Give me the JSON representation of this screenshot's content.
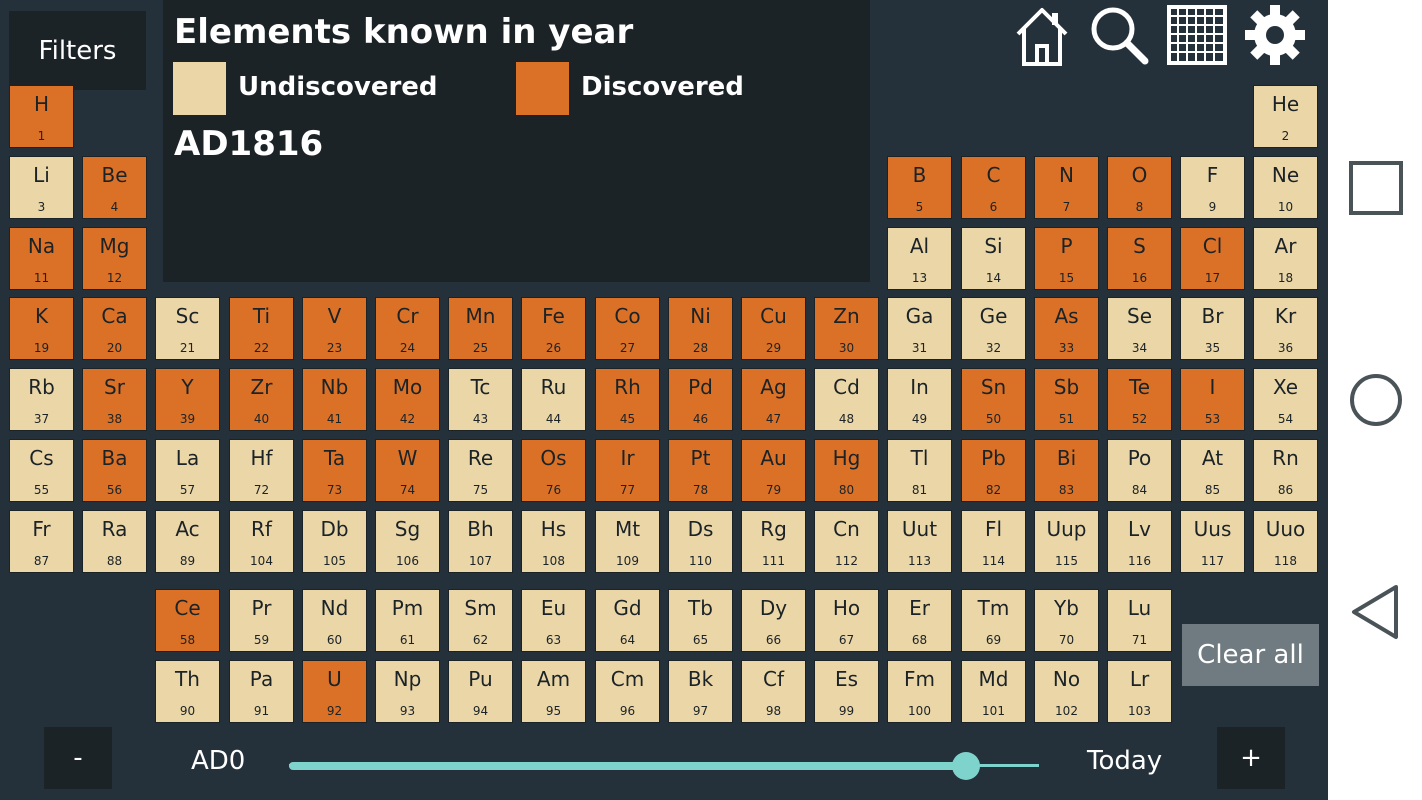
{
  "filters_label": "Filters",
  "info": {
    "title": "Elements known in year",
    "legend": {
      "undiscovered": "Undiscovered",
      "discovered": "Discovered"
    },
    "year": "AD1816"
  },
  "colors": {
    "discovered": "#db7126",
    "undiscovered": "#ebd6a7",
    "panel": "#1b2327",
    "background": "#25313a",
    "slider": "#7fd3cd"
  },
  "icons": {
    "home": "home-icon",
    "search": "search-icon",
    "grid": "grid-icon",
    "settings": "gear-icon"
  },
  "clear_all": "Clear all",
  "slider": {
    "minus": "-",
    "plus": "+",
    "start_label": "AD0",
    "end_label": "Today",
    "position_fraction": 0.902
  },
  "nav_icons": [
    "square-icon",
    "circle-icon",
    "back-triangle-icon"
  ],
  "elements": [
    {
      "sym": "H",
      "num": "1",
      "d": 1,
      "col": 1,
      "row": 1
    },
    {
      "sym": "He",
      "num": "2",
      "d": 0,
      "col": 18,
      "row": 1
    },
    {
      "sym": "Li",
      "num": "3",
      "d": 0,
      "col": 1,
      "row": 2
    },
    {
      "sym": "Be",
      "num": "4",
      "d": 1,
      "col": 2,
      "row": 2
    },
    {
      "sym": "B",
      "num": "5",
      "d": 1,
      "col": 13,
      "row": 2
    },
    {
      "sym": "C",
      "num": "6",
      "d": 1,
      "col": 14,
      "row": 2
    },
    {
      "sym": "N",
      "num": "7",
      "d": 1,
      "col": 15,
      "row": 2
    },
    {
      "sym": "O",
      "num": "8",
      "d": 1,
      "col": 16,
      "row": 2
    },
    {
      "sym": "F",
      "num": "9",
      "d": 0,
      "col": 17,
      "row": 2
    },
    {
      "sym": "Ne",
      "num": "10",
      "d": 0,
      "col": 18,
      "row": 2
    },
    {
      "sym": "Na",
      "num": "11",
      "d": 1,
      "col": 1,
      "row": 3
    },
    {
      "sym": "Mg",
      "num": "12",
      "d": 1,
      "col": 2,
      "row": 3
    },
    {
      "sym": "Al",
      "num": "13",
      "d": 0,
      "col": 13,
      "row": 3
    },
    {
      "sym": "Si",
      "num": "14",
      "d": 0,
      "col": 14,
      "row": 3
    },
    {
      "sym": "P",
      "num": "15",
      "d": 1,
      "col": 15,
      "row": 3
    },
    {
      "sym": "S",
      "num": "16",
      "d": 1,
      "col": 16,
      "row": 3
    },
    {
      "sym": "Cl",
      "num": "17",
      "d": 1,
      "col": 17,
      "row": 3
    },
    {
      "sym": "Ar",
      "num": "18",
      "d": 0,
      "col": 18,
      "row": 3
    },
    {
      "sym": "K",
      "num": "19",
      "d": 1,
      "col": 1,
      "row": 4
    },
    {
      "sym": "Ca",
      "num": "20",
      "d": 1,
      "col": 2,
      "row": 4
    },
    {
      "sym": "Sc",
      "num": "21",
      "d": 0,
      "col": 3,
      "row": 4
    },
    {
      "sym": "Ti",
      "num": "22",
      "d": 1,
      "col": 4,
      "row": 4
    },
    {
      "sym": "V",
      "num": "23",
      "d": 1,
      "col": 5,
      "row": 4
    },
    {
      "sym": "Cr",
      "num": "24",
      "d": 1,
      "col": 6,
      "row": 4
    },
    {
      "sym": "Mn",
      "num": "25",
      "d": 1,
      "col": 7,
      "row": 4
    },
    {
      "sym": "Fe",
      "num": "26",
      "d": 1,
      "col": 8,
      "row": 4
    },
    {
      "sym": "Co",
      "num": "27",
      "d": 1,
      "col": 9,
      "row": 4
    },
    {
      "sym": "Ni",
      "num": "28",
      "d": 1,
      "col": 10,
      "row": 4
    },
    {
      "sym": "Cu",
      "num": "29",
      "d": 1,
      "col": 11,
      "row": 4
    },
    {
      "sym": "Zn",
      "num": "30",
      "d": 1,
      "col": 12,
      "row": 4
    },
    {
      "sym": "Ga",
      "num": "31",
      "d": 0,
      "col": 13,
      "row": 4
    },
    {
      "sym": "Ge",
      "num": "32",
      "d": 0,
      "col": 14,
      "row": 4
    },
    {
      "sym": "As",
      "num": "33",
      "d": 1,
      "col": 15,
      "row": 4
    },
    {
      "sym": "Se",
      "num": "34",
      "d": 0,
      "col": 16,
      "row": 4
    },
    {
      "sym": "Br",
      "num": "35",
      "d": 0,
      "col": 17,
      "row": 4
    },
    {
      "sym": "Kr",
      "num": "36",
      "d": 0,
      "col": 18,
      "row": 4
    },
    {
      "sym": "Rb",
      "num": "37",
      "d": 0,
      "col": 1,
      "row": 5
    },
    {
      "sym": "Sr",
      "num": "38",
      "d": 1,
      "col": 2,
      "row": 5
    },
    {
      "sym": "Y",
      "num": "39",
      "d": 1,
      "col": 3,
      "row": 5
    },
    {
      "sym": "Zr",
      "num": "40",
      "d": 1,
      "col": 4,
      "row": 5
    },
    {
      "sym": "Nb",
      "num": "41",
      "d": 1,
      "col": 5,
      "row": 5
    },
    {
      "sym": "Mo",
      "num": "42",
      "d": 1,
      "col": 6,
      "row": 5
    },
    {
      "sym": "Tc",
      "num": "43",
      "d": 0,
      "col": 7,
      "row": 5
    },
    {
      "sym": "Ru",
      "num": "44",
      "d": 0,
      "col": 8,
      "row": 5
    },
    {
      "sym": "Rh",
      "num": "45",
      "d": 1,
      "col": 9,
      "row": 5
    },
    {
      "sym": "Pd",
      "num": "46",
      "d": 1,
      "col": 10,
      "row": 5
    },
    {
      "sym": "Ag",
      "num": "47",
      "d": 1,
      "col": 11,
      "row": 5
    },
    {
      "sym": "Cd",
      "num": "48",
      "d": 0,
      "col": 12,
      "row": 5
    },
    {
      "sym": "In",
      "num": "49",
      "d": 0,
      "col": 13,
      "row": 5
    },
    {
      "sym": "Sn",
      "num": "50",
      "d": 1,
      "col": 14,
      "row": 5
    },
    {
      "sym": "Sb",
      "num": "51",
      "d": 1,
      "col": 15,
      "row": 5
    },
    {
      "sym": "Te",
      "num": "52",
      "d": 1,
      "col": 16,
      "row": 5
    },
    {
      "sym": "I",
      "num": "53",
      "d": 1,
      "col": 17,
      "row": 5
    },
    {
      "sym": "Xe",
      "num": "54",
      "d": 0,
      "col": 18,
      "row": 5
    },
    {
      "sym": "Cs",
      "num": "55",
      "d": 0,
      "col": 1,
      "row": 6
    },
    {
      "sym": "Ba",
      "num": "56",
      "d": 1,
      "col": 2,
      "row": 6
    },
    {
      "sym": "La",
      "num": "57",
      "d": 0,
      "col": 3,
      "row": 6
    },
    {
      "sym": "Hf",
      "num": "72",
      "d": 0,
      "col": 4,
      "row": 6
    },
    {
      "sym": "Ta",
      "num": "73",
      "d": 1,
      "col": 5,
      "row": 6
    },
    {
      "sym": "W",
      "num": "74",
      "d": 1,
      "col": 6,
      "row": 6
    },
    {
      "sym": "Re",
      "num": "75",
      "d": 0,
      "col": 7,
      "row": 6
    },
    {
      "sym": "Os",
      "num": "76",
      "d": 1,
      "col": 8,
      "row": 6
    },
    {
      "sym": "Ir",
      "num": "77",
      "d": 1,
      "col": 9,
      "row": 6
    },
    {
      "sym": "Pt",
      "num": "78",
      "d": 1,
      "col": 10,
      "row": 6
    },
    {
      "sym": "Au",
      "num": "79",
      "d": 1,
      "col": 11,
      "row": 6
    },
    {
      "sym": "Hg",
      "num": "80",
      "d": 1,
      "col": 12,
      "row": 6
    },
    {
      "sym": "Tl",
      "num": "81",
      "d": 0,
      "col": 13,
      "row": 6
    },
    {
      "sym": "Pb",
      "num": "82",
      "d": 1,
      "col": 14,
      "row": 6
    },
    {
      "sym": "Bi",
      "num": "83",
      "d": 1,
      "col": 15,
      "row": 6
    },
    {
      "sym": "Po",
      "num": "84",
      "d": 0,
      "col": 16,
      "row": 6
    },
    {
      "sym": "At",
      "num": "85",
      "d": 0,
      "col": 17,
      "row": 6
    },
    {
      "sym": "Rn",
      "num": "86",
      "d": 0,
      "col": 18,
      "row": 6
    },
    {
      "sym": "Fr",
      "num": "87",
      "d": 0,
      "col": 1,
      "row": 7
    },
    {
      "sym": "Ra",
      "num": "88",
      "d": 0,
      "col": 2,
      "row": 7
    },
    {
      "sym": "Ac",
      "num": "89",
      "d": 0,
      "col": 3,
      "row": 7
    },
    {
      "sym": "Rf",
      "num": "104",
      "d": 0,
      "col": 4,
      "row": 7
    },
    {
      "sym": "Db",
      "num": "105",
      "d": 0,
      "col": 5,
      "row": 7
    },
    {
      "sym": "Sg",
      "num": "106",
      "d": 0,
      "col": 6,
      "row": 7
    },
    {
      "sym": "Bh",
      "num": "107",
      "d": 0,
      "col": 7,
      "row": 7
    },
    {
      "sym": "Hs",
      "num": "108",
      "d": 0,
      "col": 8,
      "row": 7
    },
    {
      "sym": "Mt",
      "num": "109",
      "d": 0,
      "col": 9,
      "row": 7
    },
    {
      "sym": "Ds",
      "num": "110",
      "d": 0,
      "col": 10,
      "row": 7
    },
    {
      "sym": "Rg",
      "num": "111",
      "d": 0,
      "col": 11,
      "row": 7
    },
    {
      "sym": "Cn",
      "num": "112",
      "d": 0,
      "col": 12,
      "row": 7
    },
    {
      "sym": "Uut",
      "num": "113",
      "d": 0,
      "col": 13,
      "row": 7
    },
    {
      "sym": "Fl",
      "num": "114",
      "d": 0,
      "col": 14,
      "row": 7
    },
    {
      "sym": "Uup",
      "num": "115",
      "d": 0,
      "col": 15,
      "row": 7
    },
    {
      "sym": "Lv",
      "num": "116",
      "d": 0,
      "col": 16,
      "row": 7
    },
    {
      "sym": "Uus",
      "num": "117",
      "d": 0,
      "col": 17,
      "row": 7
    },
    {
      "sym": "Uuo",
      "num": "118",
      "d": 0,
      "col": 18,
      "row": 7
    },
    {
      "sym": "Ce",
      "num": "58",
      "d": 1,
      "col": 3,
      "row": 8
    },
    {
      "sym": "Pr",
      "num": "59",
      "d": 0,
      "col": 4,
      "row": 8
    },
    {
      "sym": "Nd",
      "num": "60",
      "d": 0,
      "col": 5,
      "row": 8
    },
    {
      "sym": "Pm",
      "num": "61",
      "d": 0,
      "col": 6,
      "row": 8
    },
    {
      "sym": "Sm",
      "num": "62",
      "d": 0,
      "col": 7,
      "row": 8
    },
    {
      "sym": "Eu",
      "num": "63",
      "d": 0,
      "col": 8,
      "row": 8
    },
    {
      "sym": "Gd",
      "num": "64",
      "d": 0,
      "col": 9,
      "row": 8
    },
    {
      "sym": "Tb",
      "num": "65",
      "d": 0,
      "col": 10,
      "row": 8
    },
    {
      "sym": "Dy",
      "num": "66",
      "d": 0,
      "col": 11,
      "row": 8
    },
    {
      "sym": "Ho",
      "num": "67",
      "d": 0,
      "col": 12,
      "row": 8
    },
    {
      "sym": "Er",
      "num": "68",
      "d": 0,
      "col": 13,
      "row": 8
    },
    {
      "sym": "Tm",
      "num": "69",
      "d": 0,
      "col": 14,
      "row": 8
    },
    {
      "sym": "Yb",
      "num": "70",
      "d": 0,
      "col": 15,
      "row": 8
    },
    {
      "sym": "Lu",
      "num": "71",
      "d": 0,
      "col": 16,
      "row": 8
    },
    {
      "sym": "Th",
      "num": "90",
      "d": 0,
      "col": 3,
      "row": 9
    },
    {
      "sym": "Pa",
      "num": "91",
      "d": 0,
      "col": 4,
      "row": 9
    },
    {
      "sym": "U",
      "num": "92",
      "d": 1,
      "col": 5,
      "row": 9
    },
    {
      "sym": "Np",
      "num": "93",
      "d": 0,
      "col": 6,
      "row": 9
    },
    {
      "sym": "Pu",
      "num": "94",
      "d": 0,
      "col": 7,
      "row": 9
    },
    {
      "sym": "Am",
      "num": "95",
      "d": 0,
      "col": 8,
      "row": 9
    },
    {
      "sym": "Cm",
      "num": "96",
      "d": 0,
      "col": 9,
      "row": 9
    },
    {
      "sym": "Bk",
      "num": "97",
      "d": 0,
      "col": 10,
      "row": 9
    },
    {
      "sym": "Cf",
      "num": "98",
      "d": 0,
      "col": 11,
      "row": 9
    },
    {
      "sym": "Es",
      "num": "99",
      "d": 0,
      "col": 12,
      "row": 9
    },
    {
      "sym": "Fm",
      "num": "100",
      "d": 0,
      "col": 13,
      "row": 9
    },
    {
      "sym": "Md",
      "num": "101",
      "d": 0,
      "col": 14,
      "row": 9
    },
    {
      "sym": "No",
      "num": "102",
      "d": 0,
      "col": 15,
      "row": 9
    },
    {
      "sym": "Lr",
      "num": "103",
      "d": 0,
      "col": 16,
      "row": 9
    }
  ]
}
